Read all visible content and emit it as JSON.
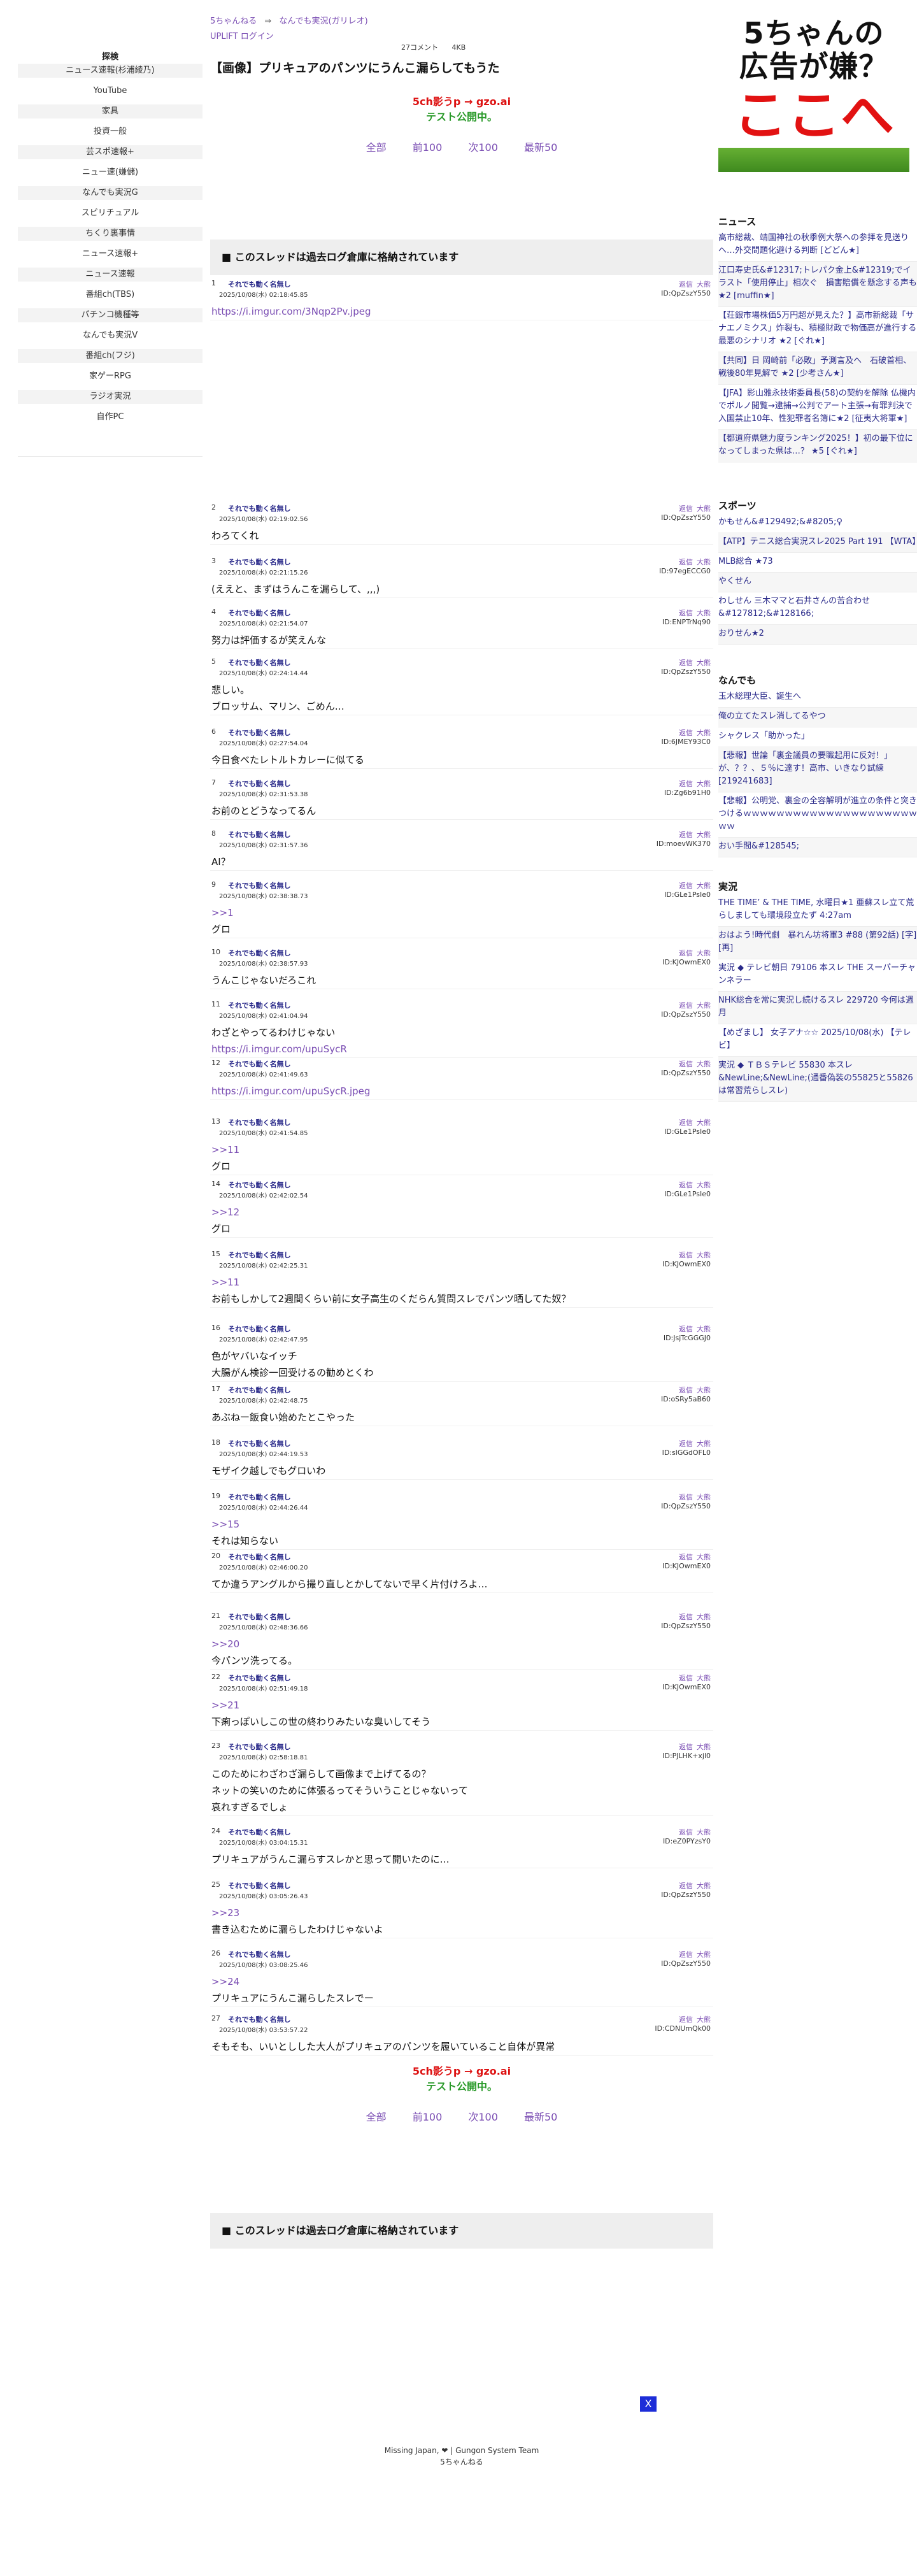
{
  "breadcrumb": {
    "home": "5ちゃんねる",
    "arrow": "⇒",
    "board": "なんでも実況(ガリレオ)"
  },
  "uplift": "UPLIFT ログイン",
  "meta": {
    "comments": "27コメント",
    "size": "4KB"
  },
  "thread_title": "【画像】プリキュアのパンツにうんこ漏らしてもうた",
  "promo": {
    "line1": "5ch影うp → gzo.ai",
    "line2": "テスト公開中。"
  },
  "nav": [
    "全部",
    "前100",
    "次100",
    "最新50"
  ],
  "archive_notice": "■ このスレッドは過去ログ倉庫に格納されています",
  "sidebar": {
    "title": "探検",
    "items": [
      "ニュース速報(杉浦綾乃)",
      "YouTube",
      "家具",
      "投資一般",
      "芸スポ速報+",
      "ニュー速(嫌儲)",
      "なんでも実況G",
      "スピリチュアル",
      "ちくり裏事情",
      "ニュース速報+",
      "ニュース速報",
      "番組ch(TBS)",
      "パチンコ機種等",
      "なんでも実況V",
      "番組ch(フジ)",
      "家ゲーRPG",
      "ラジオ実況",
      "自作PC"
    ]
  },
  "post_labels": {
    "reply": "返信",
    "big": "大熊",
    "name": "それでも動く名無し"
  },
  "posts": [
    {
      "num": "1",
      "date": "2025/10/08(水) 02:18:45.85",
      "id": "ID:QpZszY550",
      "lines": [],
      "links": [
        "https://i.imgur.com/3Nqp2Pv.jpeg"
      ]
    },
    {
      "num": "2",
      "date": "2025/10/08(水) 02:19:02.56",
      "id": "ID:QpZszY550",
      "lines": [
        "わろてくれ"
      ]
    },
    {
      "num": "3",
      "date": "2025/10/08(水) 02:21:15.26",
      "id": "ID:97egECCG0",
      "lines": [
        "(ええと、まずはうんこを漏らして、,,,)"
      ]
    },
    {
      "num": "4",
      "date": "2025/10/08(水) 02:21:54.07",
      "id": "ID:ENPTrNq90",
      "lines": [
        "努力は評価するが笑えんな"
      ]
    },
    {
      "num": "5",
      "date": "2025/10/08(水) 02:24:14.44",
      "id": "ID:QpZszY550",
      "lines": [
        "悲しい。",
        "ブロッサム、マリン、ごめん…"
      ]
    },
    {
      "num": "6",
      "date": "2025/10/08(水) 02:27:54.04",
      "id": "ID:6JMEY93C0",
      "lines": [
        "今日食べたレトルトカレーに似てる"
      ]
    },
    {
      "num": "7",
      "date": "2025/10/08(水) 02:31:53.38",
      "id": "ID:Zg6b91H0",
      "lines": [
        "お前のとどうなってるん"
      ]
    },
    {
      "num": "8",
      "date": "2025/10/08(水) 02:31:57.36",
      "id": "ID:moevWK370",
      "lines": [
        "AI？"
      ]
    },
    {
      "num": "9",
      "date": "2025/10/08(水) 02:38:38.73",
      "id": "ID:GLe1PsIe0",
      "refs": [
        ">>1"
      ],
      "lines": [
        "グロ"
      ]
    },
    {
      "num": "10",
      "date": "2025/10/08(水) 02:38:57.93",
      "id": "ID:KJOwmEX0",
      "lines": [
        "うんこじゃないだろこれ"
      ]
    },
    {
      "num": "11",
      "date": "2025/10/08(水) 02:41:04.94",
      "id": "ID:QpZszY550",
      "lines": [
        "わざとやってるわけじゃない"
      ],
      "links": [
        "https://i.imgur.com/upuSycR"
      ]
    },
    {
      "num": "12",
      "date": "2025/10/08(水) 02:41:49.63",
      "id": "ID:QpZszY550",
      "lines": [],
      "links": [
        "https://i.imgur.com/upuSycR.jpeg"
      ]
    },
    {
      "num": "13",
      "date": "2025/10/08(水) 02:41:54.85",
      "id": "ID:GLe1PsIe0",
      "refs": [
        ">>11"
      ],
      "lines": [
        "グロ"
      ]
    },
    {
      "num": "14",
      "date": "2025/10/08(水) 02:42:02.54",
      "id": "ID:GLe1PsIe0",
      "refs": [
        ">>12"
      ],
      "lines": [
        "グロ"
      ]
    },
    {
      "num": "15",
      "date": "2025/10/08(水) 02:42:25.31",
      "id": "ID:KJOwmEX0",
      "refs": [
        ">>11"
      ],
      "lines": [
        "お前もしかして2週間くらい前に女子高生のくだらん質問スレでパンツ晒してた奴？"
      ]
    },
    {
      "num": "16",
      "date": "2025/10/08(水) 02:42:47.95",
      "id": "ID:JsjTcGGGJ0",
      "lines": [
        "色がヤバいなイッチ",
        "大腸がん検診一回受けるの勧めとくわ"
      ]
    },
    {
      "num": "17",
      "date": "2025/10/08(水) 02:42:48.75",
      "id": "ID:oSRy5aB60",
      "lines": [
        "あぶねー飯食い始めたとこやった"
      ]
    },
    {
      "num": "18",
      "date": "2025/10/08(水) 02:44:19.53",
      "id": "ID:slGGdOFL0",
      "lines": [
        "モザイク越しでもグロいわ"
      ]
    },
    {
      "num": "19",
      "date": "2025/10/08(水) 02:44:26.44",
      "id": "ID:QpZszY550",
      "refs": [
        ">>15"
      ],
      "lines": [
        "それは知らない"
      ]
    },
    {
      "num": "20",
      "date": "2025/10/08(水) 02:46:00.20",
      "id": "ID:KJOwmEX0",
      "lines": [
        "てか違うアングルから撮り直しとかしてないで早く片付けろよ…"
      ]
    },
    {
      "num": "21",
      "date": "2025/10/08(水) 02:48:36.66",
      "id": "ID:QpZszY550",
      "refs": [
        ">>20"
      ],
      "lines": [
        "今パンツ洗ってる。"
      ]
    },
    {
      "num": "22",
      "date": "2025/10/08(水) 02:51:49.18",
      "id": "ID:KJOwmEX0",
      "refs": [
        ">>21"
      ],
      "lines": [
        "下痢っぽいしこの世の終わりみたいな臭いしてそう"
      ]
    },
    {
      "num": "23",
      "date": "2025/10/08(水) 02:58:18.81",
      "id": "ID:PJLHK+xjl0",
      "lines": [
        "このためにわざわざ漏らして画像まで上げてるの？",
        "ネットの笑いのために体張るってそういうことじゃないって",
        "哀れすぎるでしょ"
      ]
    },
    {
      "num": "24",
      "date": "2025/10/08(水) 03:04:15.31",
      "id": "ID:eZ0PYzsY0",
      "lines": [
        "プリキュアがうんこ漏らすスレかと思って開いたのに…"
      ]
    },
    {
      "num": "25",
      "date": "2025/10/08(水) 03:05:26.43",
      "id": "ID:QpZszY550",
      "refs": [
        ">>23"
      ],
      "lines": [
        "書き込むために漏らしたわけじゃないよ"
      ]
    },
    {
      "num": "26",
      "date": "2025/10/08(水) 03:08:25.46",
      "id": "ID:QpZszY550",
      "refs": [
        ">>24"
      ],
      "lines": [
        "プリキュアにうんこ漏らしたスレでー"
      ]
    },
    {
      "num": "27",
      "date": "2025/10/08(水) 03:53:57.22",
      "id": "ID:CDNUmQk00",
      "lines": [
        "そもそも、いいとしした大人がプリキュアのパンツを履いていること自体が異常"
      ]
    }
  ],
  "ad": {
    "line1a": "5ちゃんの",
    "line1b": "広告が嫌？",
    "line2": "ここへ"
  },
  "right": {
    "news": {
      "title": "ニュース",
      "items": [
        "高市総裁、靖国神社の秋季例大祭への参拝を見送りへ…外交問題化避ける判断 [どどん★]",
        "江口寿史氏&#12317;トレパク金上&#12319;でイラスト「使用停止」相次ぐ　損害賠償を懸念する声も ★2 [muffin★]",
        "【荘銀市場株価5万円超が見えた？】高市新総裁「サナエノミクス」炸裂も、積極財政で物価高が進行する最悪のシナリオ ★2 [ぐれ★]",
        "【共同】日 岡崎前「必敗」予測言及へ　石破首相、戦後80年見解で ★2 [少考さん★]",
        "【JFA】影山雅永技術委員長(58)の契約を解除 仏機内でポルノ閲覧→逮捕→公判でアート主張→有罪判決で入国禁止10年、性犯罪者名簿に★2 [征夷大将軍★]",
        "【都道府県魅力度ランキング2025！】初の最下位になってしまった県は…？ ★5 [ぐれ★]"
      ]
    },
    "sports": {
      "title": "スポーツ",
      "items": [
        "かもせん&#129492;&#8205;♀",
        "【ATP】テニス総合実況スレ2025 Part 191 【WTA】",
        "MLB総合 ★73",
        "やくせん",
        "わしせん 三木ママと石井さんの苦合わせ&#127812;&#128166;",
        "おりせん★2"
      ]
    },
    "nandemo": {
      "title": "なんでも",
      "items": [
        "玉木総理大臣、誕生へ",
        "俺の立てたスレ消してるやつ",
        "シャクレス「助かった」",
        "【悲報】世論「裏金議員の要職起用に反対！」が、？？、５％に達す！高市、いきなり試練 [219241683]",
        "【悲報】公明党、裏金の全容解明が進立の条件と突きつけるｗｗｗｗｗｗｗｗｗｗｗｗｗｗｗｗｗｗｗｗｗｗｗ",
        "おい手間&#128545;"
      ]
    },
    "live": {
      "title": "実況",
      "items": [
        "THE TIME’ & THE TIME, 水曜日★1 亜蘇スレ立て荒らしましても環境段立たず 4:27am",
        "おはよう!時代劇　暴れん坊将軍3 #88 (第92話) [字][再]",
        "実況 ◆ テレビ朝日 79106 本スレ THE スーパーチャンネラー",
        "NHK総合を常に実況し続けるスレ 229720 今何は週月",
        "【めざまし】 女子アナ☆☆ 2025/10/08(水) 【テレビ】",
        "実況 ◆ ＴＢＳテレビ 55830 本スレ &NewLine;&NewLine;(通番偽装の55825と55826は常習荒らしスレ)"
      ]
    }
  },
  "footer": {
    "line1": "Missing Japan, ❤ | Gungon System Team",
    "line2": "5ちゃんねる"
  },
  "close_label": "X"
}
